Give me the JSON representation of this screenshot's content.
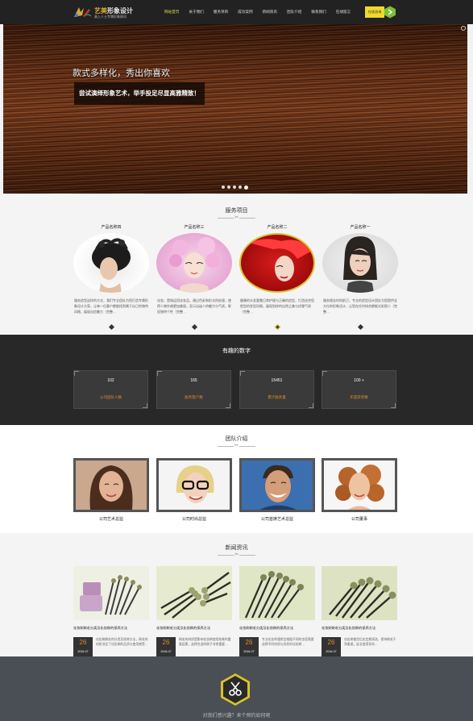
{
  "header": {
    "logo_title_accent": "艺美",
    "logo_title_rest": "形象设计",
    "logo_sub": "真上人士专属形象顾问",
    "nav": [
      "网站首页",
      "关于我们",
      "服务项目",
      "成功案例",
      "新闻资讯",
      "团队介绍",
      "联系我们",
      "在线留言"
    ],
    "consult_label": "在线咨询",
    "colors": {
      "bar": "#222222",
      "active": "#e6d64a",
      "consult": "#f1d92c"
    }
  },
  "hero": {
    "title": "款式多样化，秀出你喜欢",
    "subtitle": "尝试演绎形象艺术，举手投足尽显高雅精致！",
    "slides": 5,
    "active_slide": 4
  },
  "services": {
    "title": "服务项目",
    "items": [
      {
        "name": "产品名称四",
        "text": "服务造型这样的方式，我们专业团队为您打造专属形象设计方案，让每一位客户都能找到属于自己的独特风格，展现自信魅力（完整…",
        "icon": "diamond-icon"
      },
      {
        "name": "产品名称三",
        "text": "化妆，是指运用化妆品，通过色彩和形式的处理，使得人物外貌更加美丽，显示出迷人的魅力与气质，彰显独特个性（完整…",
        "icon": "diamond-icon"
      },
      {
        "name": "产品名称二",
        "text": "健康的头发要靠日常护理与正确的造型，打造适合您脸型的发型风格，展现别样的自然之美与优雅气质（完整…",
        "icon": "diamond-icon"
      },
      {
        "name": "产品名称一",
        "text": "服务理念时尚前卫，专业的造型设计团队为您提供全方位的形象设计，让您在任何场合都能光彩照人（完整…",
        "icon": "diamond-icon"
      }
    ]
  },
  "numbers": {
    "title": "有趣的数字",
    "items": [
      {
        "value": "102",
        "label": "公司团队人数"
      },
      {
        "value": "165",
        "label": "服务客户数"
      },
      {
        "value": "15451",
        "label": "累计服务量"
      },
      {
        "value": "100 +",
        "label": "年度获奖数"
      }
    ]
  },
  "team": {
    "title": "团队介绍",
    "members": [
      {
        "name": "公司艺术总监"
      },
      {
        "name": "公司时尚总监"
      },
      {
        "name": "公司首席艺术总监"
      },
      {
        "name": "公司董事"
      }
    ]
  },
  "news": {
    "title": "新闻资讯",
    "items": [
      {
        "title": "化妆刷刷毛分类及化妆刷的保养方法",
        "day": "26",
        "month": "2016-07",
        "text": "化妆刷刷毛的分类及保养方法，刷毛的材质决定了化妆刷的品质与使用感受…"
      },
      {
        "title": "化妆刷刷毛分类及化妆刷的保养方法",
        "day": "26",
        "month": "2016-07",
        "text": "刷毛的材质是影响化妆刷使用效果的重要因素，选择合适的刷子非常重要…"
      },
      {
        "title": "化妆刷刷毛分类及化妆刷的保养方法",
        "day": "26",
        "month": "2016-07",
        "text": "专业化妆师通常会根据不同的妆容需要选择不同材质与形状的化妆刷…"
      },
      {
        "title": "化妆刷刷毛分类及化妆刷的保养方法",
        "day": "26",
        "month": "2016-07",
        "text": "化妆刷使用后应定期清洗，保持刷毛干净柔顺，延长使用寿命…"
      }
    ]
  },
  "footer": {
    "text": "对我们感兴趣？来个预约如何呢"
  }
}
